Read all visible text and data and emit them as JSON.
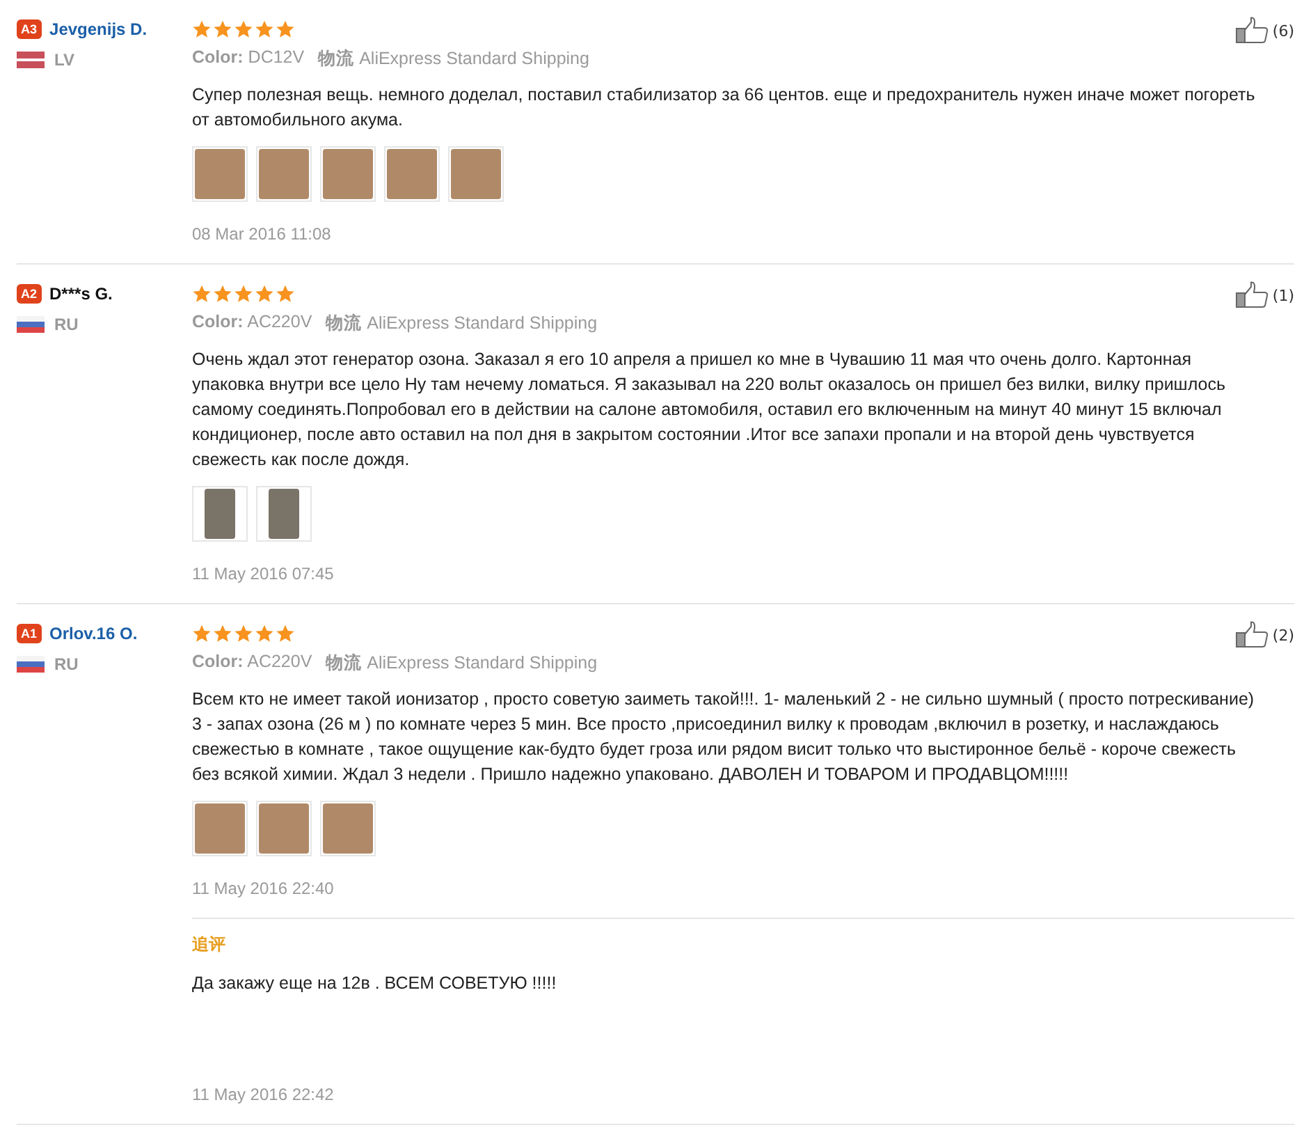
{
  "reviews": [
    {
      "level": "A3",
      "name": "Jevgenijs D.",
      "linked": true,
      "country": "LV",
      "flag": {
        "kind": "stripe"
      },
      "stars": 5,
      "likes": "(6)",
      "color_label": "Color:",
      "color_value": "DC12V",
      "shipping_label": "物流",
      "shipping_value": "AliExpress Standard Shipping",
      "text": "Супер полезная вещь. немного доделал, поставил стабилизатор за 66 центов. еще и предохранитель нужен иначе может погореть от автомобильного акума.",
      "photos": [
        {
          "kind": "square"
        },
        {
          "kind": "square"
        },
        {
          "kind": "square"
        },
        {
          "kind": "square"
        },
        {
          "kind": "square"
        }
      ],
      "date": "08 Mar 2016 11:08"
    },
    {
      "level": "A2",
      "name": "D***s G.",
      "linked": false,
      "country": "RU",
      "flag": {
        "kind": "tricolor"
      },
      "stars": 5,
      "likes": "(1)",
      "color_label": "Color:",
      "color_value": "AC220V",
      "shipping_label": "物流",
      "shipping_value": "AliExpress Standard Shipping",
      "text": "Очень ждал этот генератор озона. Заказал я его 10 апреля а пришел ко мне в Чувашию 11 мая что очень долго. Картонная упаковка внутри все цело Ну там нечему ломаться. Я заказывал на 220 вольт оказалось он пришел без вилки, вилку пришлось самому соединять.Попробовал его в действии на салоне автомобиля, оставил его включенным на минут 40 минут 15 включал кондиционер, после авто оставил на пол дня в закрытом состоянии .Итог все запахи пропали и на второй день чувствуется свежесть как после дождя.",
      "photos": [
        {
          "kind": "portrait"
        },
        {
          "kind": "portrait"
        }
      ],
      "date": "11 May 2016 07:45"
    },
    {
      "level": "A1",
      "name": "Orlov.16 O.",
      "linked": true,
      "country": "RU",
      "flag": {
        "kind": "tricolor"
      },
      "stars": 5,
      "likes": "(2)",
      "color_label": "Color:",
      "color_value": "AC220V",
      "shipping_label": "物流",
      "shipping_value": "AliExpress Standard Shipping",
      "text": "Всем кто не имеет такой ионизатор , просто советую заиметь такой!!!. 1- маленький 2 - не сильно шумный ( просто потрескивание) 3 - запах озона (26 м ) по комнате через 5 мин. Все просто ,присоединил вилку к проводам ,включил в розетку, и наслаждаюсь свежестью в комнате , такое ощущение как-будто будет гроза или рядом висит только что выстиронное бельё - короче свежесть без всякой химии. Ждал 3 недели . Пришло надежно упаковано. ДАВОЛЕН И ТОВАРОМ И ПРОДАВЦОМ!!!!!",
      "photos": [
        {
          "kind": "square"
        },
        {
          "kind": "square"
        },
        {
          "kind": "square"
        }
      ],
      "date": "11 May 2016 22:40",
      "followup": {
        "label": "追评",
        "text": "Да закажу еще на 12в . ВСЕМ СОВЕТУЮ !!!!!",
        "date": "11 May 2016 22:42"
      }
    }
  ]
}
